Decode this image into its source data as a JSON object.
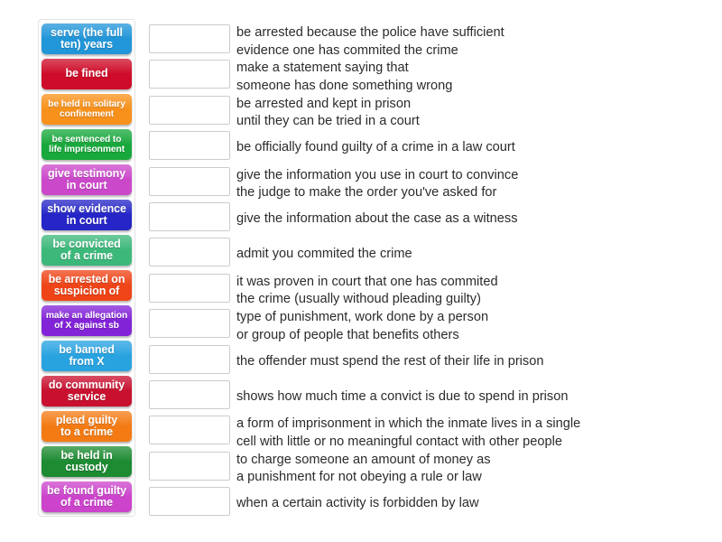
{
  "exercise": {
    "type": "match-up-drag-and-drop",
    "tray_label": "draggable-terms",
    "tile_count": 14,
    "row_count": 14
  },
  "tiles": [
    {
      "label": "serve (the full\nten) years",
      "color": "#2196d9",
      "small": false
    },
    {
      "label": "be fined",
      "color": "#ce0c29",
      "small": false
    },
    {
      "label": "be held in solitary\nconfinement",
      "color": "#f8911b",
      "small": true
    },
    {
      "label": "be sentenced to\nlife imprisonment",
      "color": "#19a83c",
      "small": true
    },
    {
      "label": "give testimony\nin court",
      "color": "#cb48cb",
      "small": false
    },
    {
      "label": "show evidence\nin court",
      "color": "#2626c8",
      "small": false
    },
    {
      "label": "be convicted\nof a crime",
      "color": "#3cb87a",
      "small": false
    },
    {
      "label": "be arrested on\nsuspicion of",
      "color": "#ef4417",
      "small": false
    },
    {
      "label": "make an allegation\nof X against sb",
      "color": "#8323d8",
      "small": true
    },
    {
      "label": "be banned\nfrom X",
      "color": "#29a3e0",
      "small": false
    },
    {
      "label": "do community\nservice",
      "color": "#c9102f",
      "small": false
    },
    {
      "label": "plead guilty\nto a crime",
      "color": "#f47b14",
      "small": false
    },
    {
      "label": "be held in\ncustody",
      "color": "#1d8b32",
      "small": false
    },
    {
      "label": "be found guilty\nof a crime",
      "color": "#cc44cc",
      "small": false
    }
  ],
  "rows": [
    {
      "definition": "be arrested because the police have sufficient\nevidence one has commited the crime",
      "lines": 2
    },
    {
      "definition": "make a statement saying that\nsomeone has done something wrong",
      "lines": 2
    },
    {
      "definition": "be arrested and kept in prison\nuntil they can be tried in a court",
      "lines": 2
    },
    {
      "definition": "be officially found guilty of a crime in a law court",
      "lines": 1
    },
    {
      "definition": "give the information you use in court to convince\nthe judge to make the order you've asked for",
      "lines": 2
    },
    {
      "definition": "give the information about the case as a witness",
      "lines": 1
    },
    {
      "definition": "admit you commited the crime",
      "lines": 1
    },
    {
      "definition": "it was proven in court that one has commited\nthe crime (usually withoud pleading guilty)",
      "lines": 2
    },
    {
      "definition": "type of punishment, work done by a person\nor group of people that benefits others",
      "lines": 2
    },
    {
      "definition": "the offender must spend the rest of their life in prison",
      "lines": 1
    },
    {
      "definition": "shows how much time a convict is due to spend in prison",
      "lines": 1
    },
    {
      "definition": "a form of imprisonment in which the inmate lives in a single\ncell with little or no meaningful contact with other people",
      "lines": 2
    },
    {
      "definition": "to charge someone an amount of money as\na punishment for not obeying a rule or law",
      "lines": 2
    },
    {
      "definition": "when a certain activity is forbidden by law",
      "lines": 1
    }
  ]
}
